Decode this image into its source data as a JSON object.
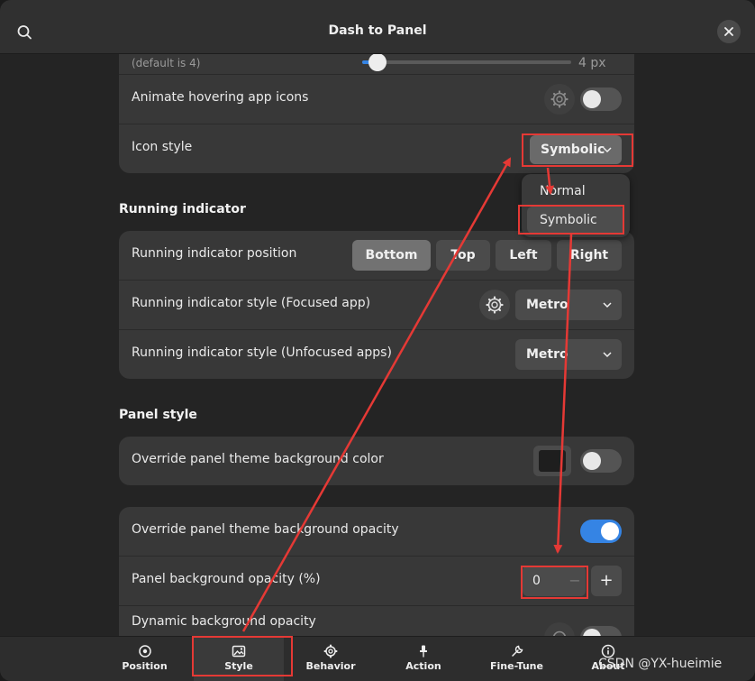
{
  "header": {
    "title": "Dash to Panel"
  },
  "icons_card": {
    "margin_row": {
      "hint": "(default is 4)",
      "value_label": "4 px",
      "slider_fraction": 0.2
    },
    "animate_row": {
      "label": "Animate hovering app icons",
      "switch_on": false
    },
    "icon_style_row": {
      "label": "Icon style",
      "selected": "Symbolic"
    }
  },
  "icon_style_popover": {
    "options": [
      "Normal",
      "Symbolic"
    ],
    "highlighted": "Symbolic"
  },
  "running_indicator": {
    "title": "Running indicator",
    "position_row": {
      "label": "Running indicator position",
      "segments": [
        "Bottom",
        "Top",
        "Left",
        "Right"
      ],
      "active": "Bottom"
    },
    "focused_row": {
      "label": "Running indicator style (Focused app)",
      "selected": "Metro"
    },
    "unfocused_row": {
      "label": "Running indicator style (Unfocused apps)",
      "selected": "Metro"
    }
  },
  "panel_style": {
    "title": "Panel style",
    "bg_color_row": {
      "label": "Override panel theme background color",
      "switch_on": false,
      "swatch": "#1e1e1e"
    },
    "bg_opacity_row": {
      "label": "Override panel theme background opacity",
      "switch_on": true
    },
    "opacity_value_row": {
      "label": "Panel background opacity (%)",
      "value": "0",
      "minus": "−",
      "plus": "+"
    },
    "dynamic_row": {
      "label": "Dynamic background opacity",
      "switch_on": false
    }
  },
  "bottom_tabs": [
    {
      "label": "Position",
      "icon": "position-icon"
    },
    {
      "label": "Style",
      "icon": "style-icon",
      "active": true
    },
    {
      "label": "Behavior",
      "icon": "behavior-icon"
    },
    {
      "label": "Action",
      "icon": "action-icon"
    },
    {
      "label": "Fine-Tune",
      "icon": "fine-tune-icon"
    },
    {
      "label": "About",
      "icon": "about-icon"
    }
  ],
  "watermark": "CSDN @YX-hueimie",
  "colors": {
    "accent": "#3584e4",
    "annotation": "#e53935",
    "window_bg": "#242424",
    "card_bg": "#383838"
  }
}
